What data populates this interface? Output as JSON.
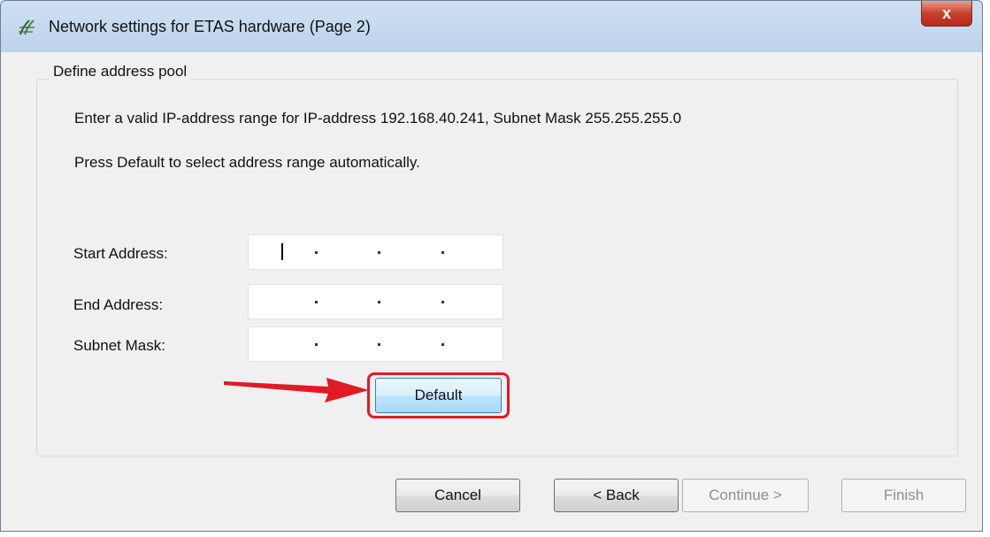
{
  "window": {
    "title": "Network settings for ETAS hardware (Page 2)",
    "close_glyph": "x",
    "icon": "etas-app-icon"
  },
  "group": {
    "legend": "Define address pool",
    "instruction": "Enter a valid IP-address range for IP-address 192.168.40.241, Subnet Mask 255.255.255.0",
    "hint": "Press Default to select address range automatically."
  },
  "fields": {
    "start_label": "Start Address:",
    "end_label": "End Address:",
    "mask_label": "Subnet Mask:"
  },
  "buttons": {
    "default": "Default",
    "cancel": "Cancel",
    "back": "< Back",
    "continue": "Continue >",
    "finish": "Finish"
  },
  "annotation": {
    "arrow_color": "#e01b24",
    "highlight_color": "#e01b24"
  }
}
